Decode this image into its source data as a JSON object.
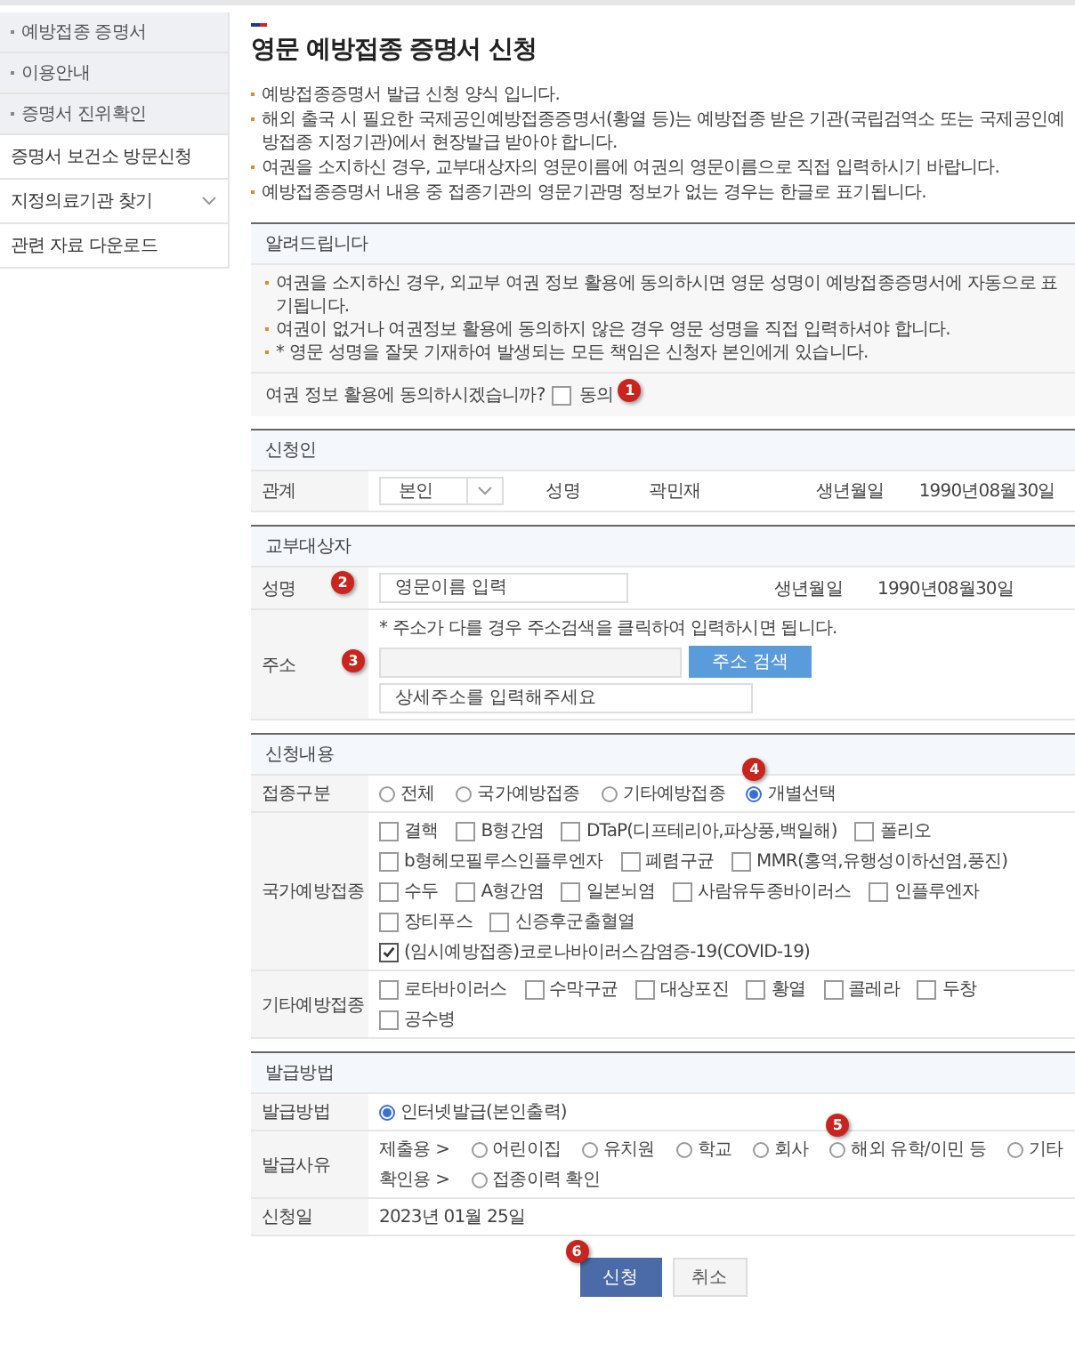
{
  "sidebar": {
    "items": [
      {
        "label": "예방접종 증명서",
        "kind": "sub",
        "expandable": false
      },
      {
        "label": "이용안내",
        "kind": "sub",
        "expandable": false
      },
      {
        "label": "증명서 진위확인",
        "kind": "sub",
        "expandable": false
      },
      {
        "label": "증명서 보건소 방문신청",
        "kind": "main",
        "expandable": false
      },
      {
        "label": "지정의료기관 찾기",
        "kind": "main",
        "expandable": true
      },
      {
        "label": "관련 자료 다운로드",
        "kind": "main",
        "expandable": false
      }
    ]
  },
  "page": {
    "title": "영문 예방접종 증명서 신청",
    "intro": [
      "예방접종증명서 발급 신청 양식 입니다.",
      "해외 출국 시 필요한 국제공인예방접종증명서(황열 등)는 예방접종 받은 기관(국립검역소 또는 국제공인예방접종 지정기관)에서 현장발급 받아야 합니다.",
      "여권을 소지하신 경우, 교부대상자의 영문이름에 여권의 영문이름으로 직접 입력하시기 바랍니다.",
      "예방접종증명서 내용 중 접종기관의 영문기관명 정보가 없는 경우는 한글로 표기됩니다."
    ]
  },
  "notice": {
    "title": "알려드립니다",
    "lines": [
      "여권을 소지하신 경우, 외교부 여권 정보 활용에 동의하시면 영문 성명이 예방접종증명서에 자동으로 표기됩니다.",
      "여권이 없거나 여권정보 활용에 동의하지 않은 경우 영문 성명을 직접 입력하셔야 합니다.",
      "* 영문 성명을 잘못 기재하여 발생되는 모든 책임은 신청자 본인에게 있습니다."
    ],
    "consent": {
      "question": "여권 정보 활용에 동의하시겠습니까?",
      "label": "동의",
      "checked": false,
      "callout": "1"
    }
  },
  "applicant": {
    "title": "신청인",
    "fields": [
      {
        "label": "관계",
        "kind": "select",
        "value": "본인"
      },
      {
        "label": "성명",
        "kind": "text",
        "value": "곽민재"
      },
      {
        "label": "생년월일",
        "kind": "text",
        "value": "1990년08월30일"
      }
    ]
  },
  "recipient": {
    "title": "교부대상자",
    "name": {
      "label": "성명",
      "placeholder": "영문이름 입력",
      "callout": "2"
    },
    "birth": {
      "label": "생년월일",
      "value": "1990년08월30일"
    },
    "address": {
      "label": "주소",
      "note": "* 주소가 다를 경우 주소검색을 클릭하여 입력하시면 됩니다.",
      "search_button": "주소 검색",
      "detail_placeholder": "상세주소를 입력해주세요",
      "callout": "3"
    }
  },
  "application": {
    "title": "신청내용",
    "type": {
      "label": "접종구분",
      "options": [
        {
          "label": "전체",
          "selected": false
        },
        {
          "label": "국가예방접종",
          "selected": false
        },
        {
          "label": "기타예방접종",
          "selected": false
        },
        {
          "label": "개별선택",
          "selected": true,
          "callout": "4"
        }
      ]
    },
    "groups": [
      {
        "label": "국가예방접종",
        "items": [
          {
            "label": "결핵",
            "checked": false
          },
          {
            "label": "B형간염",
            "checked": false
          },
          {
            "label": "DTaP(디프테리아,파상풍,백일해)",
            "checked": false
          },
          {
            "label": "폴리오",
            "checked": false
          },
          {
            "label": "b형헤모필루스인플루엔자",
            "checked": false
          },
          {
            "label": "폐렴구균",
            "checked": false
          },
          {
            "label": "MMR(홍역,유행성이하선염,풍진)",
            "checked": false
          },
          {
            "label": "수두",
            "checked": false
          },
          {
            "label": "A형간염",
            "checked": false
          },
          {
            "label": "일본뇌염",
            "checked": false
          },
          {
            "label": "사람유두종바이러스",
            "checked": false
          },
          {
            "label": "인플루엔자",
            "checked": false
          },
          {
            "label": "장티푸스",
            "checked": false
          },
          {
            "label": "신증후군출혈열",
            "checked": false
          },
          {
            "label": "(임시예방접종)코로나바이러스감염증-19(COVID-19)",
            "checked": true
          }
        ]
      },
      {
        "label": "기타예방접종",
        "items": [
          {
            "label": "로타바이러스",
            "checked": false
          },
          {
            "label": "수막구균",
            "checked": false
          },
          {
            "label": "대상포진",
            "checked": false
          },
          {
            "label": "황열",
            "checked": false
          },
          {
            "label": "콜레라",
            "checked": false
          },
          {
            "label": "두창",
            "checked": false
          },
          {
            "label": "공수병",
            "checked": false
          }
        ]
      }
    ]
  },
  "issuance": {
    "title": "발급방법",
    "method": {
      "label": "발급방법",
      "options": [
        {
          "label": "인터넷발급(본인출력)",
          "selected": true
        }
      ]
    },
    "reason": {
      "label": "발급사유",
      "groups": [
        {
          "prefix": "제출용 >",
          "options": [
            {
              "label": "어린이집",
              "selected": false
            },
            {
              "label": "유치원",
              "selected": false
            },
            {
              "label": "학교",
              "selected": false
            },
            {
              "label": "회사",
              "selected": false
            },
            {
              "label": "해외 유학/이민 등",
              "selected": false,
              "callout": "5"
            },
            {
              "label": "기타",
              "selected": false
            }
          ]
        },
        {
          "prefix": "확인용 >",
          "options": [
            {
              "label": "접종이력 확인",
              "selected": false
            }
          ]
        }
      ]
    },
    "date": {
      "label": "신청일",
      "value": "2023년 01월 25일"
    }
  },
  "buttons": [
    {
      "label": "신청",
      "kind": "primary",
      "callout": "6"
    },
    {
      "label": "취소",
      "kind": "secondary"
    }
  ]
}
